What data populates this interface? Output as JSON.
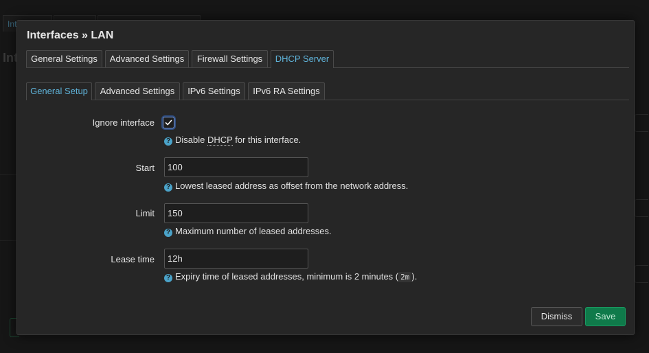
{
  "background": {
    "tab_fragment": "Int",
    "title_fragment": "Int"
  },
  "modal": {
    "title": "Interfaces » LAN",
    "main_tabs": [
      {
        "label": "General Settings",
        "active": false
      },
      {
        "label": "Advanced Settings",
        "active": false
      },
      {
        "label": "Firewall Settings",
        "active": false
      },
      {
        "label": "DHCP Server",
        "active": true
      }
    ],
    "sub_tabs": [
      {
        "label": "General Setup",
        "active": true
      },
      {
        "label": "Advanced Settings",
        "active": false
      },
      {
        "label": "IPv6 Settings",
        "active": false
      },
      {
        "label": "IPv6 RA Settings",
        "active": false
      }
    ],
    "fields": {
      "ignore_interface": {
        "label": "Ignore interface",
        "checked": true,
        "help_before": "Disable ",
        "help_abbr": "DHCP",
        "help_after": " for this interface."
      },
      "start": {
        "label": "Start",
        "value": "100",
        "help": "Lowest leased address as offset from the network address."
      },
      "limit": {
        "label": "Limit",
        "value": "150",
        "help": "Maximum number of leased addresses."
      },
      "leasetime": {
        "label": "Lease time",
        "value": "12h",
        "help_before": "Expiry time of leased addresses, minimum is 2 minutes (",
        "help_code": "2m",
        "help_after": ")."
      }
    },
    "buttons": {
      "dismiss": "Dismiss",
      "save": "Save"
    }
  },
  "colors": {
    "accent": "#5fb3d9",
    "save": "#0f7a4a",
    "help_icon": "#4ba3c9"
  },
  "icons": {
    "help": "question-circle-icon",
    "check": "checkmark-icon"
  }
}
